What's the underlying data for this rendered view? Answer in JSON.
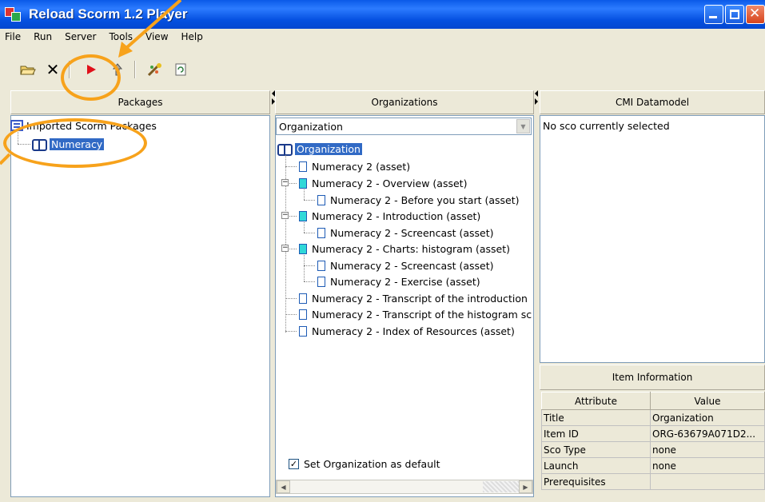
{
  "window": {
    "title": "Reload Scorm 1.2 Player"
  },
  "menu": [
    "File",
    "Run",
    "Server",
    "Tools",
    "View",
    "Help"
  ],
  "toolbar": {
    "icons": [
      "open-folder-icon",
      "delete-icon",
      "run-icon",
      "upload-icon",
      "wizard-icon",
      "refresh-icon"
    ],
    "colors": {
      "run": "#E0101A"
    }
  },
  "packages": {
    "header": "Packages",
    "root": "Imported Scorm Packages",
    "child": "Numeracy"
  },
  "organizations": {
    "header": "Organizations",
    "dropdown_value": "Organization",
    "tree_root": "Organization",
    "items": [
      "Numeracy 2 (asset)",
      "Numeracy 2 - Overview (asset)",
      "Numeracy 2 - Before you start (asset)",
      "Numeracy 2 - Introduction (asset)",
      "Numeracy 2 - Screencast (asset)",
      "Numeracy 2 - Charts: histogram (asset)",
      "Numeracy 2 - Screencast (asset)",
      "Numeracy 2 - Exercise (asset)",
      "Numeracy 2 - Transcript of the introduction",
      "Numeracy 2 - Transcript of the histogram sc",
      "Numeracy 2 - Index of Resources (asset)"
    ],
    "default_checkbox_label": "Set Organization as default",
    "default_checked": true
  },
  "cmi": {
    "header": "CMI Datamodel",
    "status": "No sco currently selected"
  },
  "item_info": {
    "header": "Item Information",
    "col_attribute": "Attribute",
    "col_value": "Value",
    "rows": [
      {
        "attribute": "Title",
        "value": "Organization"
      },
      {
        "attribute": "Item ID",
        "value": "ORG-63679A071D2..."
      },
      {
        "attribute": "Sco Type",
        "value": "none"
      },
      {
        "attribute": "Launch",
        "value": "none"
      },
      {
        "attribute": "Prerequisites",
        "value": ""
      }
    ]
  },
  "annotation": {
    "color": "#F7A21B"
  }
}
